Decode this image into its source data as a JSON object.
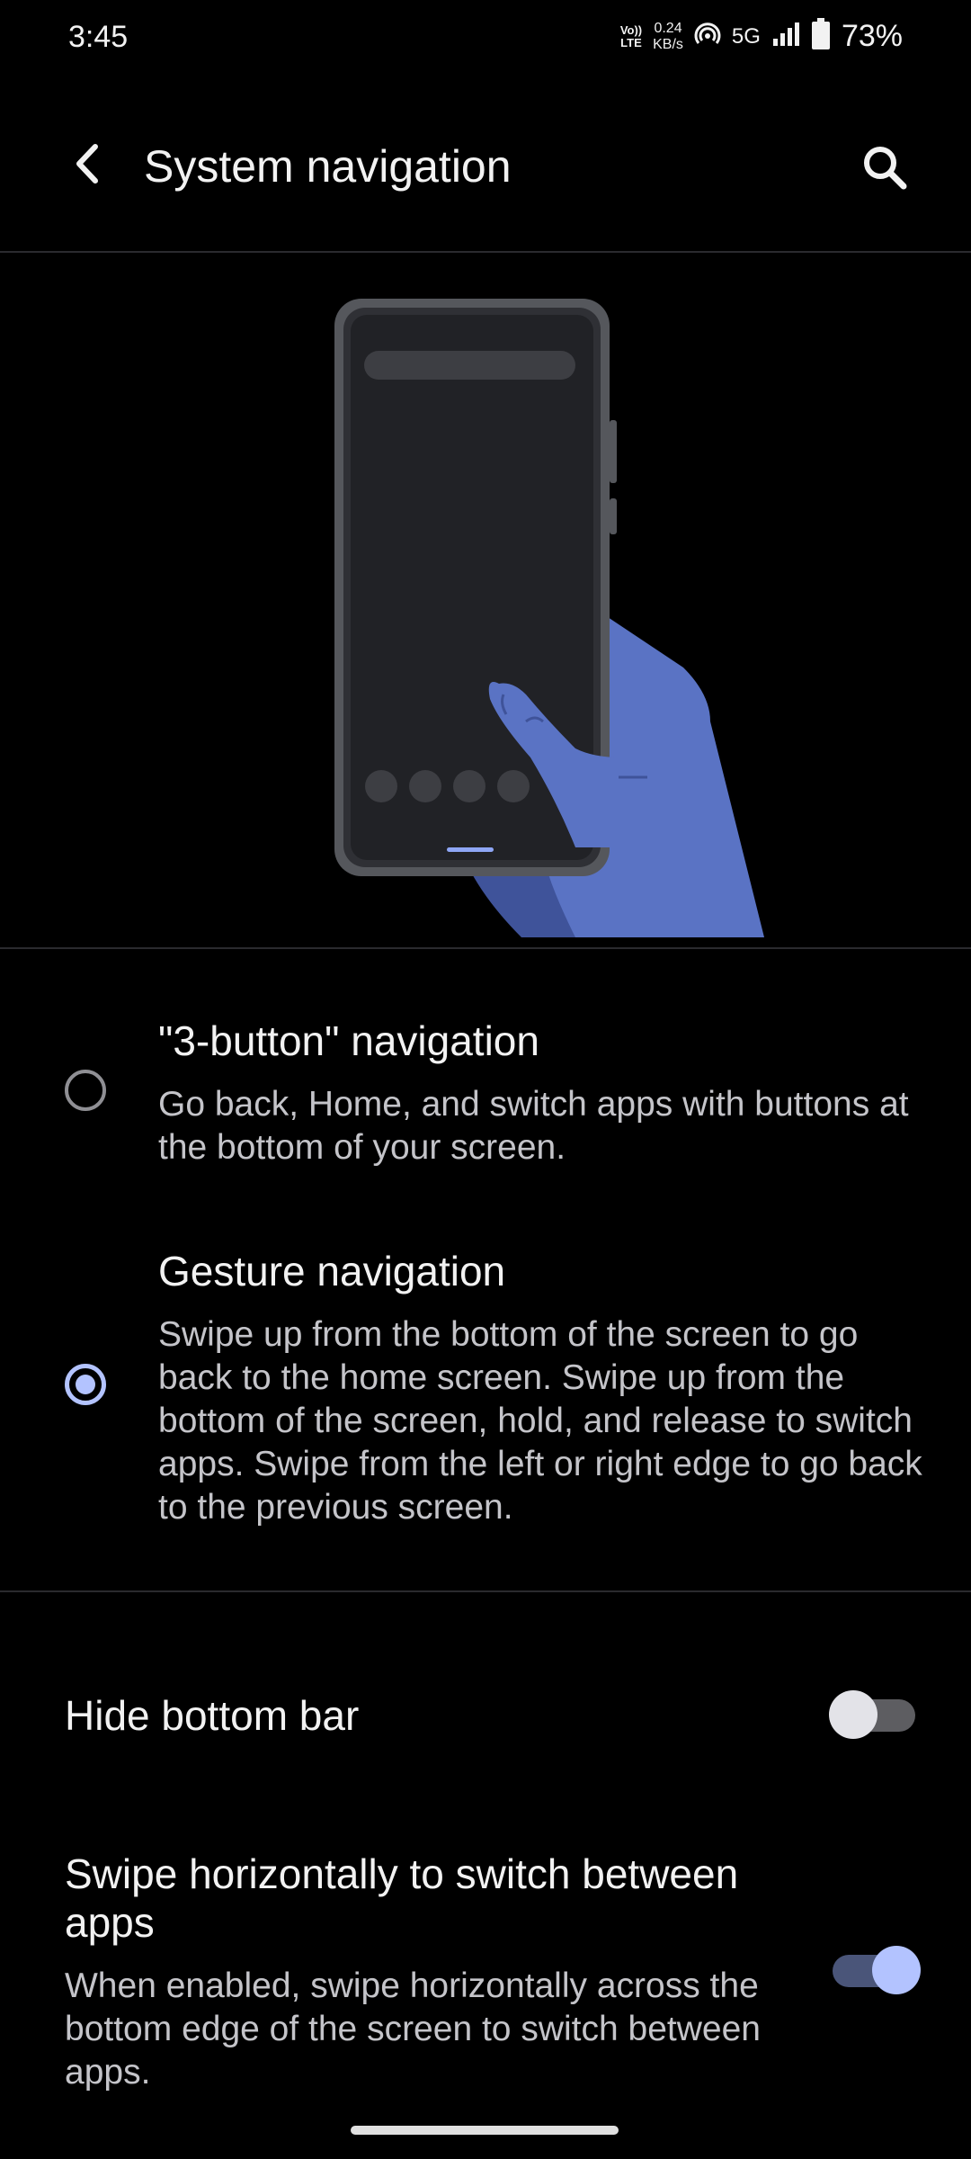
{
  "status_bar": {
    "time": "3:45",
    "volte_top": "Vo))",
    "volte_bottom": "LTE",
    "net_speed_value": "0.24",
    "net_speed_unit": "KB/s",
    "network": "5G",
    "battery_percent": "73%"
  },
  "header": {
    "title": "System navigation"
  },
  "options": [
    {
      "title": "\"3-button\" navigation",
      "description": "Go back, Home, and switch apps with buttons at the bottom of your screen.",
      "selected": false
    },
    {
      "title": "Gesture navigation",
      "description": "Swipe up from the bottom of the screen to go back to the home screen. Swipe up from the bottom of the screen, hold, and release to switch apps. Swipe from the left or right edge to go back to the previous screen.",
      "selected": true
    }
  ],
  "settings": {
    "hide_bottom_bar": {
      "title": "Hide bottom bar",
      "enabled": false
    },
    "swipe_horizontally": {
      "title": "Swipe horizontally to switch between apps",
      "description": "When enabled, swipe horizontally across the bottom edge of the screen to switch between apps.",
      "enabled": true
    }
  },
  "colors": {
    "accent": "#b3c3ff",
    "background": "#000000",
    "hand": "#5a73c4"
  },
  "icons": {
    "back": "arrow-back-icon",
    "search": "search-icon",
    "wifi_hotspot": "hotspot-icon",
    "signal": "signal-icon",
    "battery": "battery-icon"
  }
}
